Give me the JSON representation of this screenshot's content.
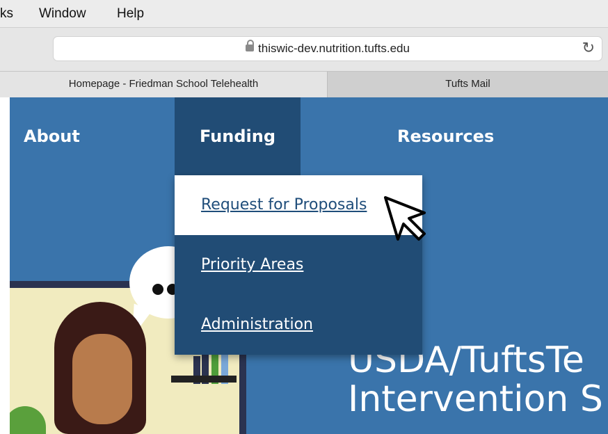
{
  "menubar": {
    "items": [
      "ks",
      "Window",
      "Help"
    ]
  },
  "address_bar": {
    "url": "thiswic-dev.nutrition.tufts.edu",
    "lock_icon": "lock-icon",
    "reload_icon": "reload-icon"
  },
  "tabs": [
    {
      "label": "Homepage - Friedman School Telehealth",
      "active": true
    },
    {
      "label": "Tufts Mail",
      "active": false
    }
  ],
  "site": {
    "nav": {
      "about": "About",
      "funding": "Funding",
      "resources": "Resources"
    },
    "dropdown": {
      "items": [
        "Request for Proposals",
        "Priority Areas",
        "Administration"
      ],
      "hovered": "Request for Proposals"
    },
    "headline": {
      "line1": "USDA/TuftsTe",
      "line2": "Intervention S"
    }
  },
  "colors": {
    "site_blue": "#3a74ab",
    "nav_dark": "#214c75",
    "white": "#ffffff"
  }
}
